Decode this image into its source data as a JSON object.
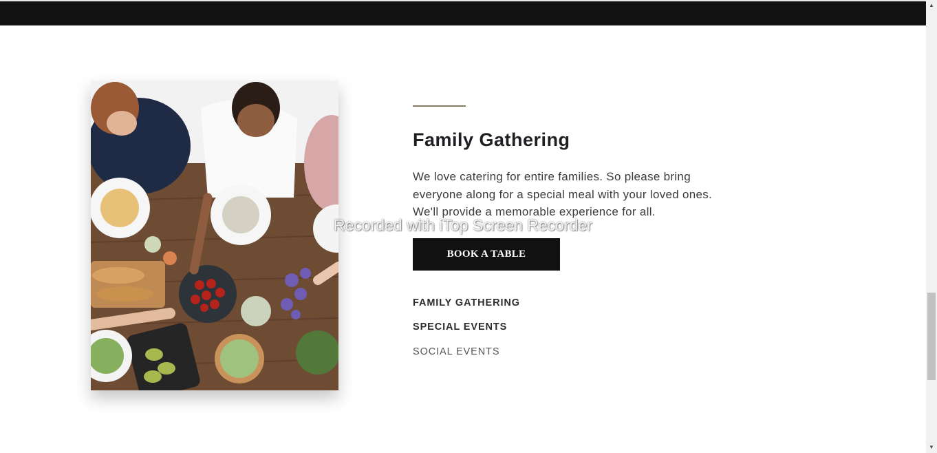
{
  "section": {
    "heading": "Family Gathering",
    "description": "We love catering for entire families. So please bring everyone along for a special meal with your loved ones. We'll provide a memorable experience for all.",
    "cta_label": "BOOK A TABLE"
  },
  "event_links": [
    {
      "label": "FAMILY GATHERING"
    },
    {
      "label": "SPECIAL EVENTS"
    },
    {
      "label": "SOCIAL EVENTS"
    }
  ],
  "watermark": "Recorded with iTop Screen Recorder",
  "colors": {
    "header_bar": "#111111",
    "button_bg": "#111111",
    "divider": "#8a7c64",
    "heading_text": "#1d1f22"
  }
}
